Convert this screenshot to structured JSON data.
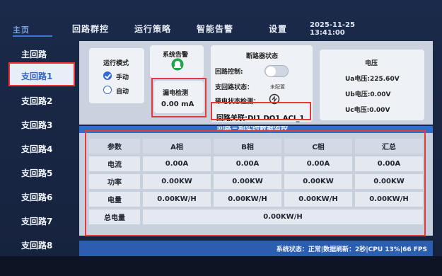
{
  "nav": {
    "logo": "主页",
    "items": [
      "回路群控",
      "运行策略",
      "智能告警",
      "设置"
    ],
    "date": "2025-11-25",
    "time": "13:41:00"
  },
  "sidebar": {
    "items": [
      {
        "label": "主回路"
      },
      {
        "label": "支回路1",
        "active": true
      },
      {
        "label": "支回路2"
      },
      {
        "label": "支回路3"
      },
      {
        "label": "支回路4"
      },
      {
        "label": "支回路5"
      },
      {
        "label": "支回路6"
      },
      {
        "label": "支回路7"
      },
      {
        "label": "支回路8"
      }
    ]
  },
  "run_mode": {
    "title": "运行模式",
    "manual": "手动",
    "auto": "自动",
    "selected": "manual"
  },
  "alarm": {
    "title": "系统告警"
  },
  "leakage": {
    "title": "漏电检测",
    "value": "0.00 mA"
  },
  "breaker": {
    "title": "断路器状态",
    "loop_control": "回路控制:",
    "branch_status": "支回路状态：",
    "branch_status_value": "未配置",
    "live_check": "带电状态检测：",
    "link": "回路关联:DI1 DO1 ACI_1"
  },
  "voltage": {
    "title": "电压",
    "ua": "Ua电压:225.60V",
    "ub": "Ub电压:0.00V",
    "uc": "Uc电压:0.00V"
  },
  "table": {
    "title": "回路三相实时数据监控",
    "headers": [
      "参数",
      "A相",
      "B相",
      "C相",
      "汇总"
    ],
    "rows": [
      [
        "电流",
        "0.00A",
        "0.00A",
        "0.00A",
        "0.00A"
      ],
      [
        "功率",
        "0.00KW",
        "0.00KW",
        "0.00KW",
        "0.00KW"
      ],
      [
        "电量",
        "0.00KW/H",
        "0.00KW/H",
        "0.00KW/H",
        "0.00KW/H"
      ]
    ],
    "total_label": "总电量",
    "total_value": "0.00KW/H"
  },
  "status_bar": "系统状态：正常|数据刷新：2秒|CPU 13%|66 FPS",
  "colors": {
    "accent": "#2c6fd1",
    "highlight": "#e43a3a",
    "panel": "#c9d2de"
  }
}
